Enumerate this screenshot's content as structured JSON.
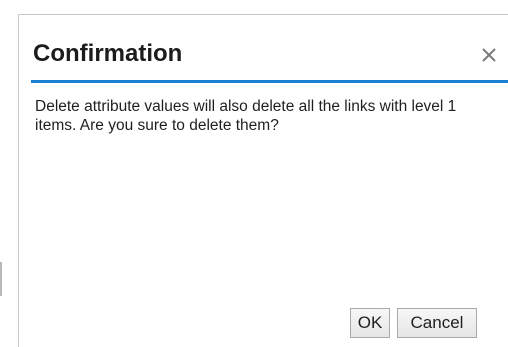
{
  "dialog": {
    "title": "Confirmation",
    "close_icon": "close-icon",
    "message": "Delete attribute values will also delete all the links with level 1 items. Are you sure to delete them?",
    "ok_label": "OK",
    "cancel_label": "Cancel"
  },
  "colors": {
    "accent": "#1a7fd1",
    "border": "#c8c8c8"
  }
}
